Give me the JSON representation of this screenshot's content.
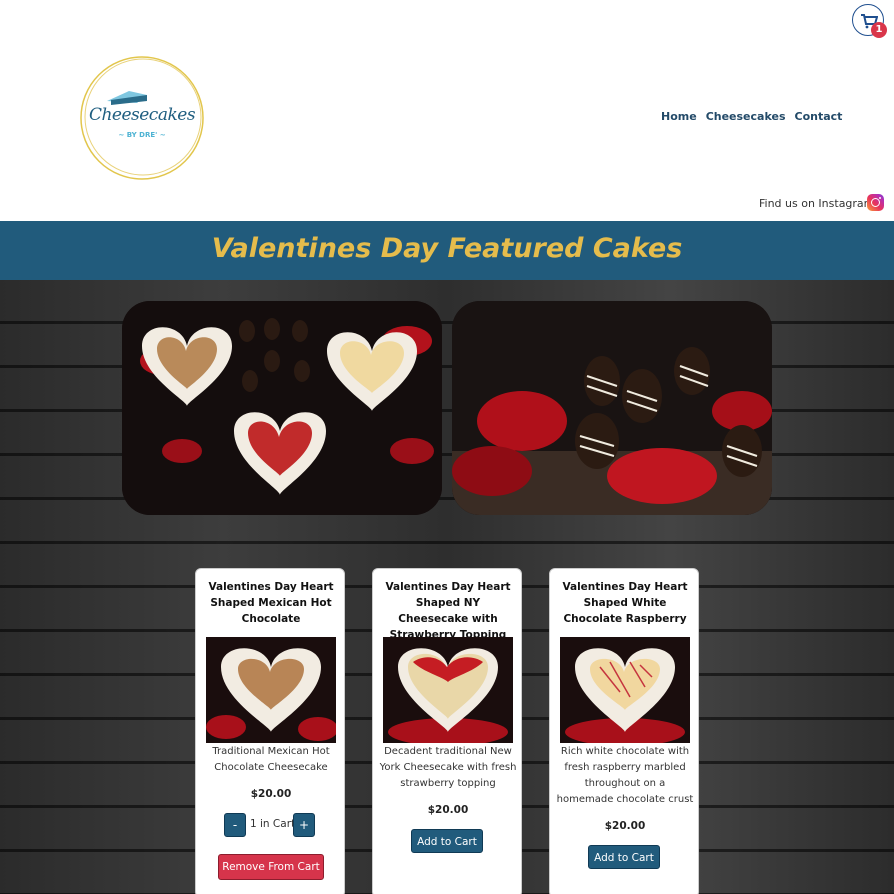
{
  "header": {
    "logo": {
      "name": "Cheesecakes",
      "sub": "~ BY DRE' ~"
    },
    "nav": [
      "Home",
      "Cheesecakes",
      "Contact"
    ],
    "cart_count": "1",
    "instagram_text": "Find us on Instagram"
  },
  "banner": {
    "title": "Valentines Day Featured Cakes"
  },
  "products": [
    {
      "title": "Valentines Day Heart Shaped Mexican Hot Chocolate",
      "description": "Traditional Mexican Hot Chocolate Cheesecake",
      "price": "$20.00",
      "qty_minus": "-",
      "qty_label": "1 in Cart",
      "qty_plus": "+",
      "action": "Remove From Cart"
    },
    {
      "title": "Valentines Day Heart Shaped NY Cheesecake with Strawberry Topping",
      "description": "Decadent traditional New York Cheesecake with fresh strawberry topping",
      "price": "$20.00",
      "action": "Add to Cart"
    },
    {
      "title": "Valentines Day Heart Shaped White Chocolate Raspberry",
      "description": "Rich white chocolate with fresh raspberry marbled throughout on a homemade chocolate crust",
      "price": "$20.00",
      "action": "Add to Cart"
    }
  ],
  "colors": {
    "banner_bg": "#215b7c",
    "banner_text": "#e5bc4c",
    "primary_button": "#215b7c",
    "danger_button": "#d6344b"
  }
}
